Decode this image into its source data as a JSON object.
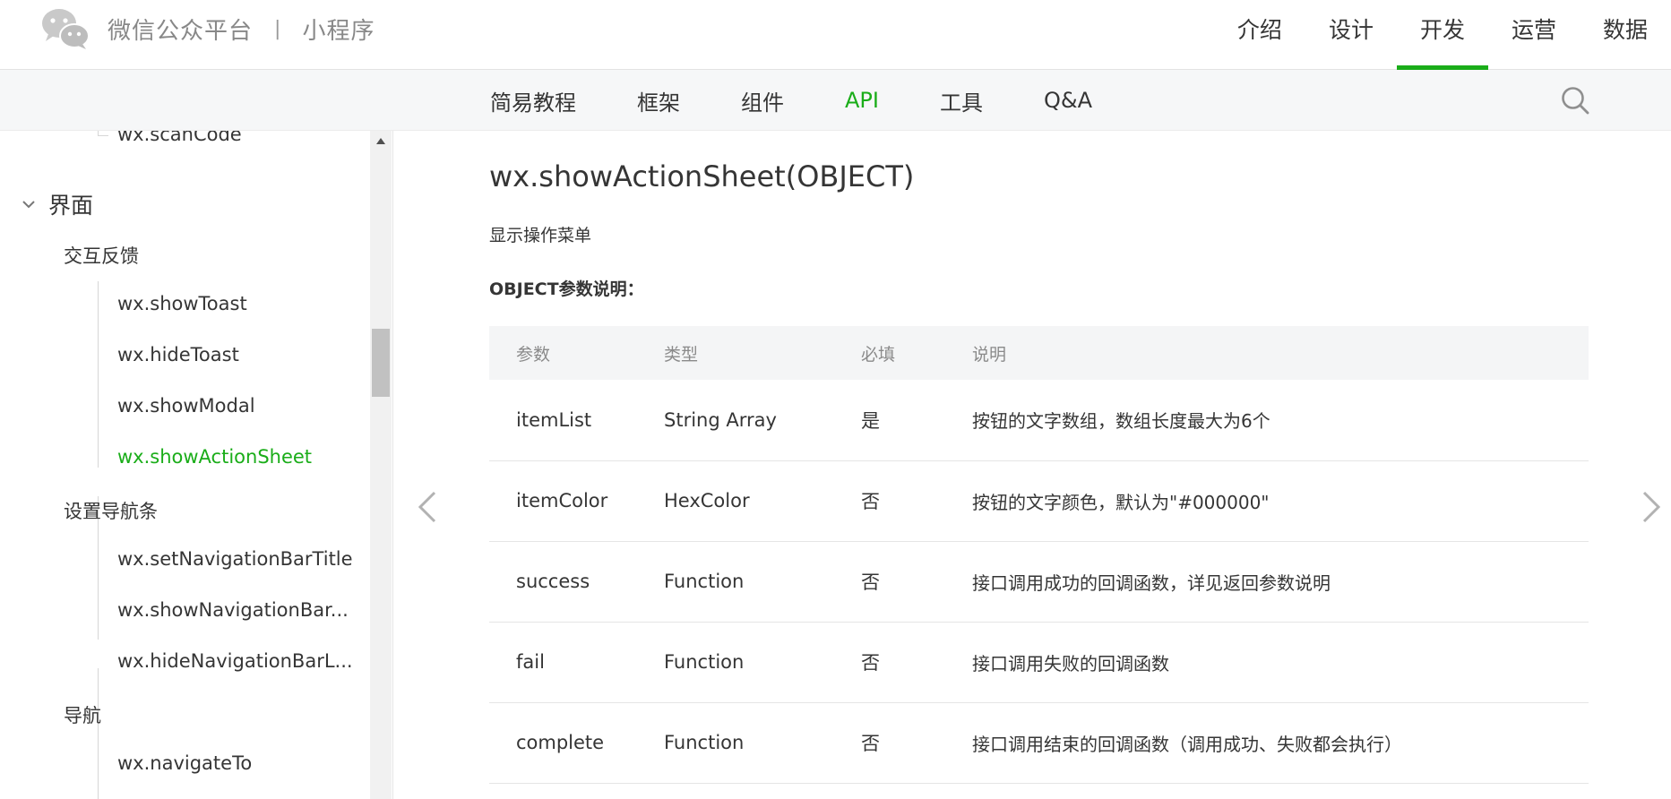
{
  "header": {
    "brand_name": "微信公众平台",
    "brand_separator": "|",
    "brand_sub": "小程序",
    "logo_icon": "wechat-logo-icon",
    "nav": [
      {
        "label": "介绍"
      },
      {
        "label": "设计"
      },
      {
        "label": "开发",
        "active": true
      },
      {
        "label": "运营"
      },
      {
        "label": "数据"
      }
    ]
  },
  "subnav": {
    "items": [
      {
        "label": "简易教程"
      },
      {
        "label": "框架"
      },
      {
        "label": "组件"
      },
      {
        "label": "API",
        "active": true
      },
      {
        "label": "工具"
      },
      {
        "label": "Q&A"
      }
    ],
    "search_icon": "search-icon"
  },
  "sidebar": {
    "partial_top_item": "wx.scanCode",
    "section": "界面",
    "groups": [
      {
        "label": "交互反馈",
        "items": [
          "wx.showToast",
          "wx.hideToast",
          "wx.showModal",
          "wx.showActionSheet"
        ]
      },
      {
        "label": "设置导航条",
        "items": [
          "wx.setNavigationBarTitle",
          "wx.showNavigationBar...",
          "wx.hideNavigationBarL..."
        ]
      },
      {
        "label": "导航",
        "items": [
          "wx.navigateTo"
        ]
      }
    ],
    "active_item": "wx.showActionSheet"
  },
  "main": {
    "title": "wx.showActionSheet(OBJECT)",
    "description": "显示操作菜单",
    "params_label": "OBJECT参数说明：",
    "table": {
      "headers": [
        "参数",
        "类型",
        "必填",
        "说明"
      ],
      "rows": [
        [
          "itemList",
          "String Array",
          "是",
          "按钮的文字数组，数组长度最大为6个"
        ],
        [
          "itemColor",
          "HexColor",
          "否",
          "按钮的文字颜色，默认为\"#000000\""
        ],
        [
          "success",
          "Function",
          "否",
          "接口调用成功的回调函数，详见返回参数说明"
        ],
        [
          "fail",
          "Function",
          "否",
          "接口调用失败的回调函数"
        ],
        [
          "complete",
          "Function",
          "否",
          "接口调用结束的回调函数（调用成功、失败都会执行）"
        ]
      ]
    }
  },
  "colors": {
    "accent": "#1aad19",
    "text": "#353535",
    "muted": "#888888",
    "subbar_bg": "#f6f7f8",
    "table_header_bg": "#f4f5f6"
  }
}
